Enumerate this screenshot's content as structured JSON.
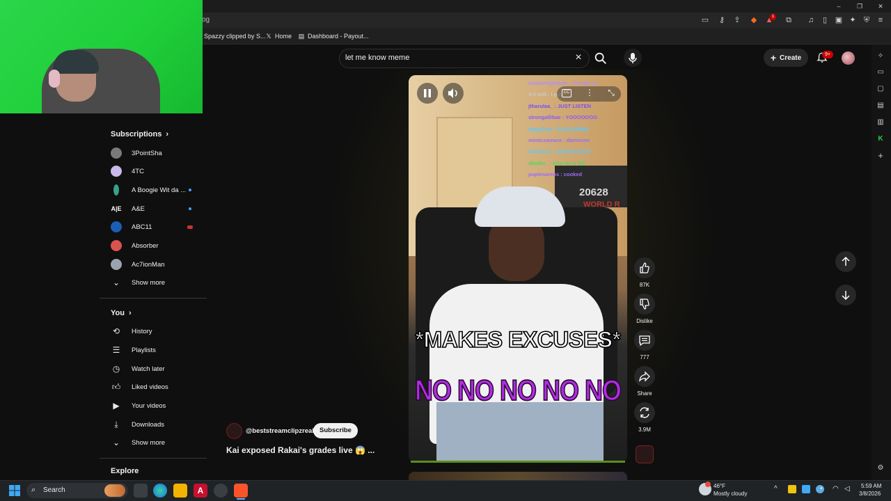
{
  "browser": {
    "url_fragment": "og",
    "bookmarks": [
      "Spazzy clipped by S...",
      "Home",
      "Dashboard - Payout..."
    ],
    "extension_badge": "1"
  },
  "search": {
    "query": "let me know meme"
  },
  "header": {
    "create_label": "Create",
    "notif_count": "9+"
  },
  "sidebar": {
    "subscriptions_heading": "Subscriptions",
    "subscriptions": [
      {
        "name": "3PointSha",
        "color": "#7a7a7a"
      },
      {
        "name": "4TC",
        "color": "#c9b8e8"
      },
      {
        "name": "A Boogie Wit da ...",
        "color": "#3aa08a"
      },
      {
        "name": "A&E",
        "color": "#ffffff"
      },
      {
        "name": "ABC11",
        "color": "#1a5fb4"
      },
      {
        "name": "Absorber",
        "color": "#d9534f"
      },
      {
        "name": "Ac7ionMan",
        "color": "#9aa4b0"
      }
    ],
    "show_more": "Show more",
    "you_heading": "You",
    "you_items": [
      "History",
      "Playlists",
      "Watch later",
      "Liked videos",
      "Your videos",
      "Downloads",
      "Show more"
    ],
    "explore_heading": "Explore"
  },
  "video": {
    "caption_top": "*MAKES EXCUSES*",
    "caption_bottom": "NO NO NO NO NO",
    "overlay_number": "20628",
    "overlay_text": "WORLD R",
    "chat": [
      "GelatoHighNote : I'm him or",
      "4-5 mill : I pro",
      "jtharulaa_ : JUST LISTEN",
      "strongallibae : YOOOOOOO",
      "bigppluto : DAAAAMMM",
      "mimicsamara : damnnnn",
      "taisley12 : LMAOOOOOO",
      "dballer_ : how do u fail",
      "puplesareus : cooked"
    ],
    "channel_handle": "@beststreamclipzreal",
    "subscribe_label": "Subscribe",
    "title": "Kai exposed Rakai's grades live 😱 ...",
    "actions": {
      "likes": "87K",
      "dislike": "Dislike",
      "comments": "777",
      "share": "Share",
      "remix": "3.9M"
    }
  },
  "taskbar": {
    "search_label": "Search",
    "weather_temp": "46°F",
    "weather_cond": "Mostly cloudy",
    "time": "5:59 AM",
    "date": "3/8/2026"
  }
}
